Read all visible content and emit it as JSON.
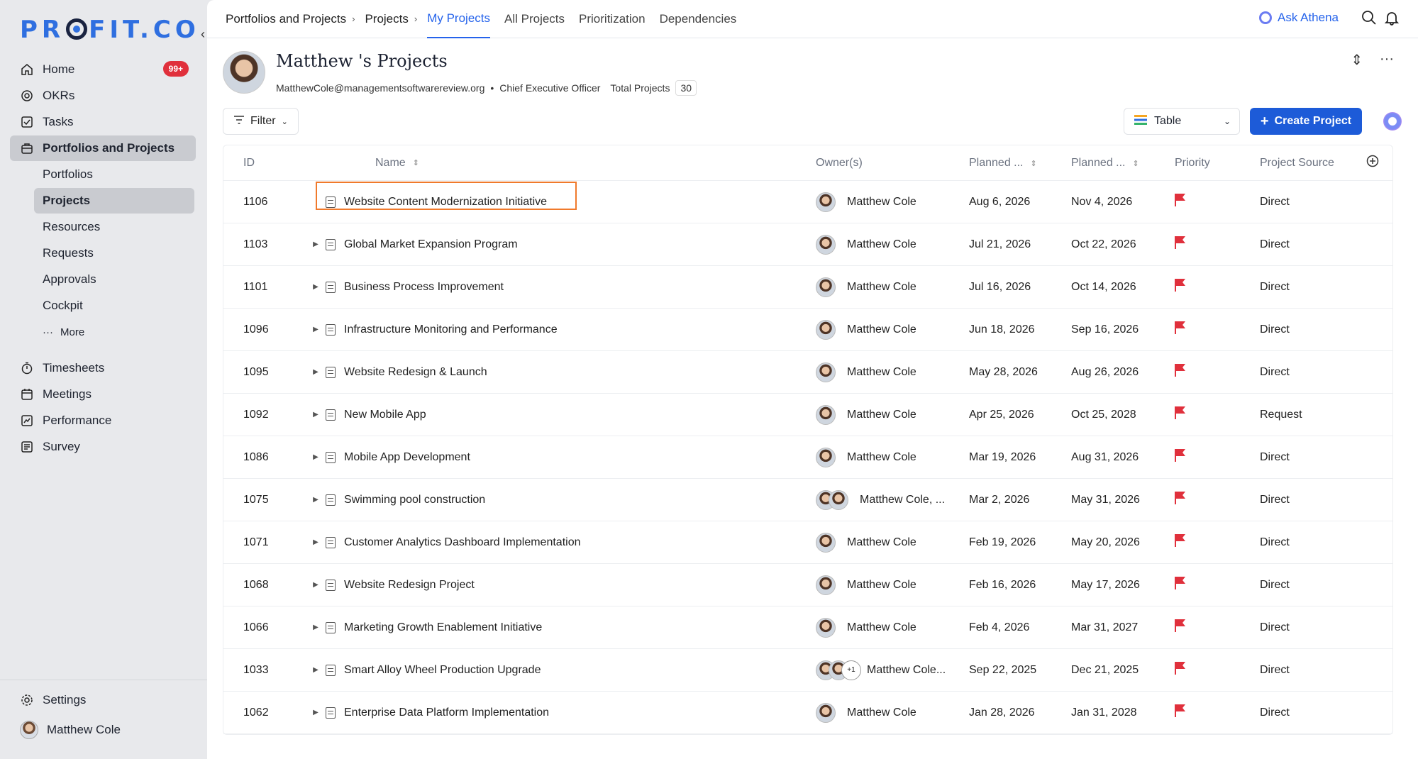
{
  "brand": {
    "logo_pre": "PR",
    "logo_post": "FIT.CO"
  },
  "sidebar": {
    "items": [
      {
        "label": "Home",
        "icon": "home-icon",
        "badge": "99+"
      },
      {
        "label": "OKRs",
        "icon": "target-icon"
      },
      {
        "label": "Tasks",
        "icon": "checkbox-icon"
      },
      {
        "label": "Portfolios and Projects",
        "icon": "briefcase-icon",
        "active": true
      }
    ],
    "sub_items": [
      {
        "label": "Portfolios"
      },
      {
        "label": "Projects",
        "active": true
      },
      {
        "label": "Resources"
      },
      {
        "label": "Requests"
      },
      {
        "label": "Approvals"
      },
      {
        "label": "Cockpit"
      },
      {
        "label": "More"
      }
    ],
    "items2": [
      {
        "label": "Timesheets",
        "icon": "stopwatch-icon"
      },
      {
        "label": "Meetings",
        "icon": "calendar-icon"
      },
      {
        "label": "Performance",
        "icon": "chart-icon"
      },
      {
        "label": "Survey",
        "icon": "survey-icon"
      }
    ],
    "settings": "Settings",
    "user": "Matthew Cole"
  },
  "topbar": {
    "crumbs": [
      "Portfolios and Projects",
      "Projects"
    ],
    "tabs": [
      "My Projects",
      "All Projects",
      "Prioritization",
      "Dependencies"
    ],
    "ask": "Ask Athena"
  },
  "header": {
    "title": "Matthew 's Projects",
    "email": "MatthewCole@managementsoftwarereview.org",
    "role": "Chief Executive Officer",
    "total_label": "Total Projects",
    "total": "30"
  },
  "toolbar": {
    "filter": "Filter",
    "view": "Table",
    "create": "Create Project"
  },
  "table": {
    "columns": [
      "ID",
      "Name",
      "Owner(s)",
      "Planned ...",
      "Planned ...",
      "Priority",
      "Project Source"
    ],
    "rows": [
      {
        "id": "1106",
        "name": "Website Content Modernization Initiative",
        "owner": "Matthew Cole",
        "start": "Aug 6, 2026",
        "end": "Nov 4, 2026",
        "source": "Direct"
      },
      {
        "id": "1103",
        "name": "Global Market Expansion Program",
        "owner": "Matthew Cole",
        "start": "Jul 21, 2026",
        "end": "Oct 22, 2026",
        "source": "Direct"
      },
      {
        "id": "1101",
        "name": "Business Process Improvement",
        "owner": "Matthew Cole",
        "start": "Jul 16, 2026",
        "end": "Oct 14, 2026",
        "source": "Direct"
      },
      {
        "id": "1096",
        "name": "Infrastructure Monitoring and Performance",
        "owner": "Matthew Cole",
        "start": "Jun 18, 2026",
        "end": "Sep 16, 2026",
        "source": "Direct"
      },
      {
        "id": "1095",
        "name": "Website Redesign & Launch",
        "owner": "Matthew Cole",
        "start": "May 28, 2026",
        "end": "Aug 26, 2026",
        "source": "Direct"
      },
      {
        "id": "1092",
        "name": "New Mobile App",
        "owner": "Matthew Cole",
        "start": "Apr 25, 2026",
        "end": "Oct 25, 2028",
        "source": "Request"
      },
      {
        "id": "1086",
        "name": "Mobile App Development",
        "owner": "Matthew Cole",
        "start": "Mar 19, 2026",
        "end": "Aug 31, 2026",
        "source": "Direct"
      },
      {
        "id": "1075",
        "name": "Swimming pool construction",
        "owner": "Matthew Cole, ...",
        "start": "Mar 2, 2026",
        "end": "May 31, 2026",
        "source": "Direct"
      },
      {
        "id": "1071",
        "name": "Customer Analytics Dashboard Implementation",
        "owner": "Matthew Cole",
        "start": "Feb 19, 2026",
        "end": "May 20, 2026",
        "source": "Direct"
      },
      {
        "id": "1068",
        "name": "Website Redesign Project",
        "owner": "Matthew Cole",
        "start": "Feb 16, 2026",
        "end": "May 17, 2026",
        "source": "Direct"
      },
      {
        "id": "1066",
        "name": "Marketing Growth Enablement Initiative",
        "owner": "Matthew Cole",
        "start": "Feb 4, 2026",
        "end": "Mar 31, 2027",
        "source": "Direct"
      },
      {
        "id": "1033",
        "name": "Smart Alloy Wheel Production Upgrade",
        "owner": "Matthew Cole...",
        "extra": "+1",
        "start": "Sep 22, 2025",
        "end": "Dec 21, 2025",
        "source": "Direct"
      },
      {
        "id": "1062",
        "name": "Enterprise Data Platform Implementation",
        "owner": "Matthew Cole",
        "start": "Jan 28, 2026",
        "end": "Jan 31, 2028",
        "source": "Direct"
      }
    ]
  },
  "colors": {
    "accent": "#2563eb",
    "create": "#1d5bd8",
    "flag": "#e0303c",
    "highlight": "#f07a2c"
  }
}
